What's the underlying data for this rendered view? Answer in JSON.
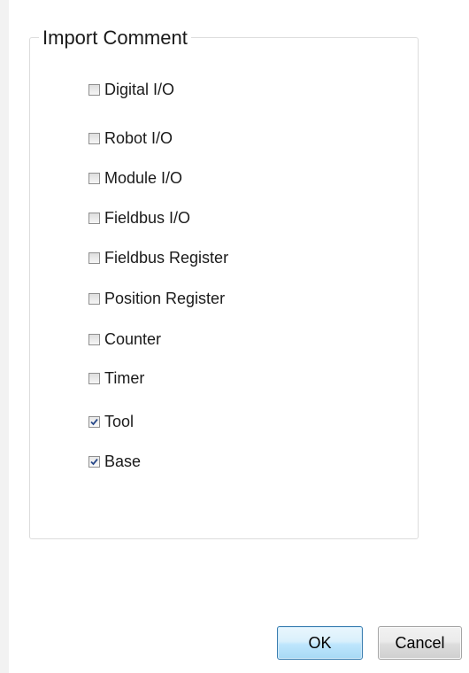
{
  "group": {
    "title": "Import Comment"
  },
  "options": [
    {
      "label": "Digital I/O",
      "checked": false
    },
    {
      "label": "Robot I/O",
      "checked": false
    },
    {
      "label": "Module I/O",
      "checked": false
    },
    {
      "label": "Fieldbus I/O",
      "checked": false
    },
    {
      "label": "Fieldbus Register",
      "checked": false
    },
    {
      "label": "Position Register",
      "checked": false
    },
    {
      "label": "Counter",
      "checked": false
    },
    {
      "label": "Timer",
      "checked": false
    },
    {
      "label": "Tool",
      "checked": true
    },
    {
      "label": "Base",
      "checked": true
    }
  ],
  "buttons": {
    "ok_label": "OK",
    "cancel_label": "Cancel"
  },
  "colors": {
    "checkmark": "#2a4a8a",
    "ok_border": "#3c7fb1"
  }
}
